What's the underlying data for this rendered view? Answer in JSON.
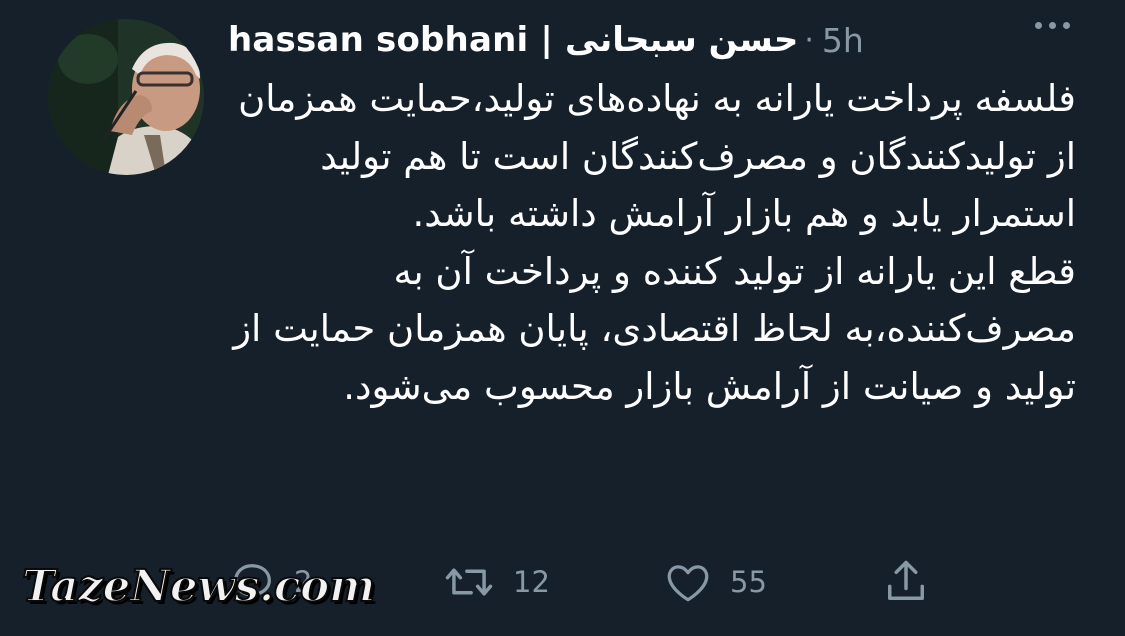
{
  "tweet": {
    "author_name": "hassan sobhani | حسن سبحانی",
    "separator": "·",
    "timestamp": "5h",
    "paragraph1": "فلسفه پرداخت یارانه به نهاده‌های تولید،حمایت همزمان از تولیدکنندگان و مصرف‌کنندگان است تا هم تولید استمرار یابد و هم بازار آرامش داشته باشد.",
    "paragraph2": "قطع این یارانه از تولید کننده و پرداخت آن به مصرف‌کننده،به لحاظ اقتصادی، پایان همزمان حمایت از تولید و صیانت از آرامش بازار محسوب می‌شود."
  },
  "actions": {
    "reply_count": "2",
    "retweet_count": "12",
    "like_count": "55"
  },
  "watermark": {
    "text": "TazeNews.com"
  },
  "icons": {
    "more": "more-horizontal-icon",
    "reply": "reply-icon",
    "retweet": "retweet-icon",
    "like": "heart-icon",
    "share": "share-icon"
  },
  "colors": {
    "background": "#15202b",
    "text": "#ffffff",
    "secondary": "#8899a6"
  }
}
